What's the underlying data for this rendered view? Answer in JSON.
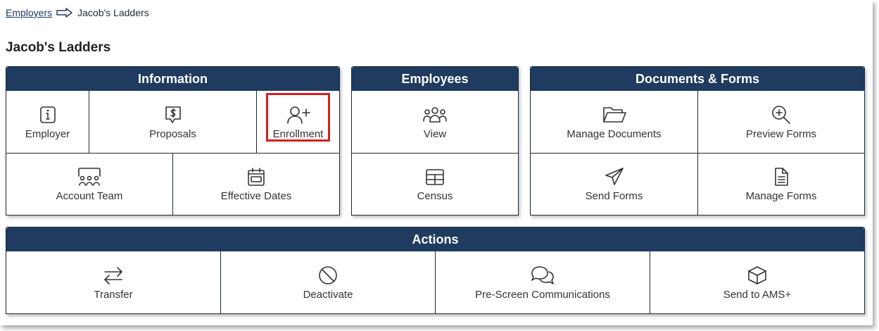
{
  "breadcrumb": {
    "root": "Employers",
    "current": "Jacob's Ladders"
  },
  "page_title": "Jacob's Ladders",
  "information": {
    "title": "Information",
    "employer": "Employer",
    "proposals": "Proposals",
    "enrollment": "Enrollment",
    "account_team": "Account Team",
    "effective_dates": "Effective Dates"
  },
  "employees": {
    "title": "Employees",
    "view": "View",
    "census": "Census"
  },
  "documents": {
    "title": "Documents & Forms",
    "manage_documents": "Manage Documents",
    "preview_forms": "Preview Forms",
    "send_forms": "Send Forms",
    "manage_forms": "Manage Forms"
  },
  "actions": {
    "title": "Actions",
    "transfer": "Transfer",
    "deactivate": "Deactivate",
    "prescreen": "Pre-Screen Communications",
    "send_ams": "Send to AMS+"
  },
  "colors": {
    "header_bg": "#1f3b5f",
    "highlight": "#d42020",
    "link": "#1f3a66"
  },
  "icons": {
    "employer": "info-icon",
    "proposals": "dollar-speech-icon",
    "enrollment": "add-user-icon",
    "account_team": "team-icon",
    "effective_dates": "calendar-icon",
    "view": "people-icon",
    "census": "table-icon",
    "manage_documents": "folder-icon",
    "preview_forms": "zoom-in-icon",
    "send_forms": "paper-plane-icon",
    "manage_forms": "document-icon",
    "transfer": "transfer-arrows-icon",
    "deactivate": "ban-icon",
    "prescreen": "chat-bubbles-icon",
    "send_ams": "cube-icon"
  }
}
